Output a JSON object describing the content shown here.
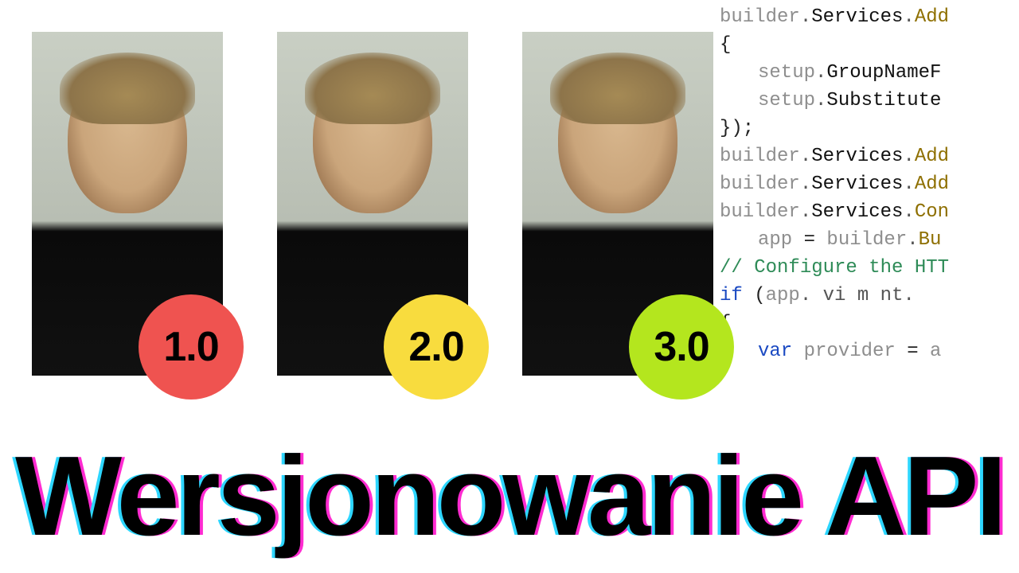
{
  "title": "Wersjonowanie API",
  "badges": [
    {
      "label": "1.0",
      "color": "red"
    },
    {
      "label": "2.0",
      "color": "yellow"
    },
    {
      "label": "3.0",
      "color": "green"
    }
  ],
  "code_lines": [
    [
      {
        "cls": "tok-ident",
        "t": "builder"
      },
      {
        "cls": "tok-dot",
        "t": "."
      },
      {
        "cls": "tok-member",
        "t": "Services"
      },
      {
        "cls": "tok-dot",
        "t": "."
      },
      {
        "cls": "tok-method",
        "t": "Add"
      }
    ],
    [
      {
        "cls": "tok-punc",
        "t": "{"
      }
    ],
    [
      {
        "cls": "indent",
        "t": ""
      },
      {
        "cls": "tok-ident",
        "t": "setup"
      },
      {
        "cls": "tok-dot",
        "t": "."
      },
      {
        "cls": "tok-member",
        "t": "GroupNameF"
      }
    ],
    [
      {
        "cls": "indent",
        "t": ""
      },
      {
        "cls": "tok-ident",
        "t": "setup"
      },
      {
        "cls": "tok-dot",
        "t": "."
      },
      {
        "cls": "tok-member",
        "t": "Substitute"
      }
    ],
    [
      {
        "cls": "tok-punc",
        "t": "});"
      }
    ],
    [
      {
        "cls": "",
        "t": " "
      }
    ],
    [
      {
        "cls": "",
        "t": " "
      }
    ],
    [
      {
        "cls": "tok-ident",
        "t": "builder"
      },
      {
        "cls": "tok-dot",
        "t": "."
      },
      {
        "cls": "tok-member",
        "t": "Services"
      },
      {
        "cls": "tok-dot",
        "t": "."
      },
      {
        "cls": "tok-method",
        "t": "Add"
      }
    ],
    [
      {
        "cls": "tok-ident",
        "t": "builder"
      },
      {
        "cls": "tok-dot",
        "t": "."
      },
      {
        "cls": "tok-member",
        "t": "Services"
      },
      {
        "cls": "tok-dot",
        "t": "."
      },
      {
        "cls": "tok-method",
        "t": "Add"
      }
    ],
    [
      {
        "cls": "tok-ident",
        "t": "builder"
      },
      {
        "cls": "tok-dot",
        "t": "."
      },
      {
        "cls": "tok-member",
        "t": "Services"
      },
      {
        "cls": "tok-dot",
        "t": "."
      },
      {
        "cls": "tok-method",
        "t": "Con"
      }
    ],
    [
      {
        "cls": "",
        "t": " "
      }
    ],
    [
      {
        "cls": "",
        "t": " "
      }
    ],
    [
      {
        "cls": "indent",
        "t": ""
      },
      {
        "cls": "tok-ident",
        "t": "app "
      },
      {
        "cls": "tok-punc",
        "t": "= "
      },
      {
        "cls": "tok-ident",
        "t": "builder"
      },
      {
        "cls": "tok-dot",
        "t": "."
      },
      {
        "cls": "tok-method",
        "t": "Bu"
      }
    ],
    [
      {
        "cls": "",
        "t": " "
      }
    ],
    [
      {
        "cls": "tok-comment",
        "t": "// Configure the HTT"
      }
    ],
    [
      {
        "cls": "tok-kw",
        "t": "if "
      },
      {
        "cls": "tok-punc",
        "t": "("
      },
      {
        "cls": "tok-ident",
        "t": "app"
      },
      {
        "cls": "tok-dot",
        "t": ".     vi    m  nt."
      }
    ],
    [
      {
        "cls": "tok-punc",
        "t": "{"
      }
    ],
    [
      {
        "cls": "",
        "t": " "
      }
    ],
    [
      {
        "cls": "indent",
        "t": ""
      },
      {
        "cls": "tok-kw",
        "t": "var "
      },
      {
        "cls": "tok-ident",
        "t": "provider "
      },
      {
        "cls": "tok-punc",
        "t": "= "
      },
      {
        "cls": "tok-ident",
        "t": "a"
      }
    ]
  ]
}
